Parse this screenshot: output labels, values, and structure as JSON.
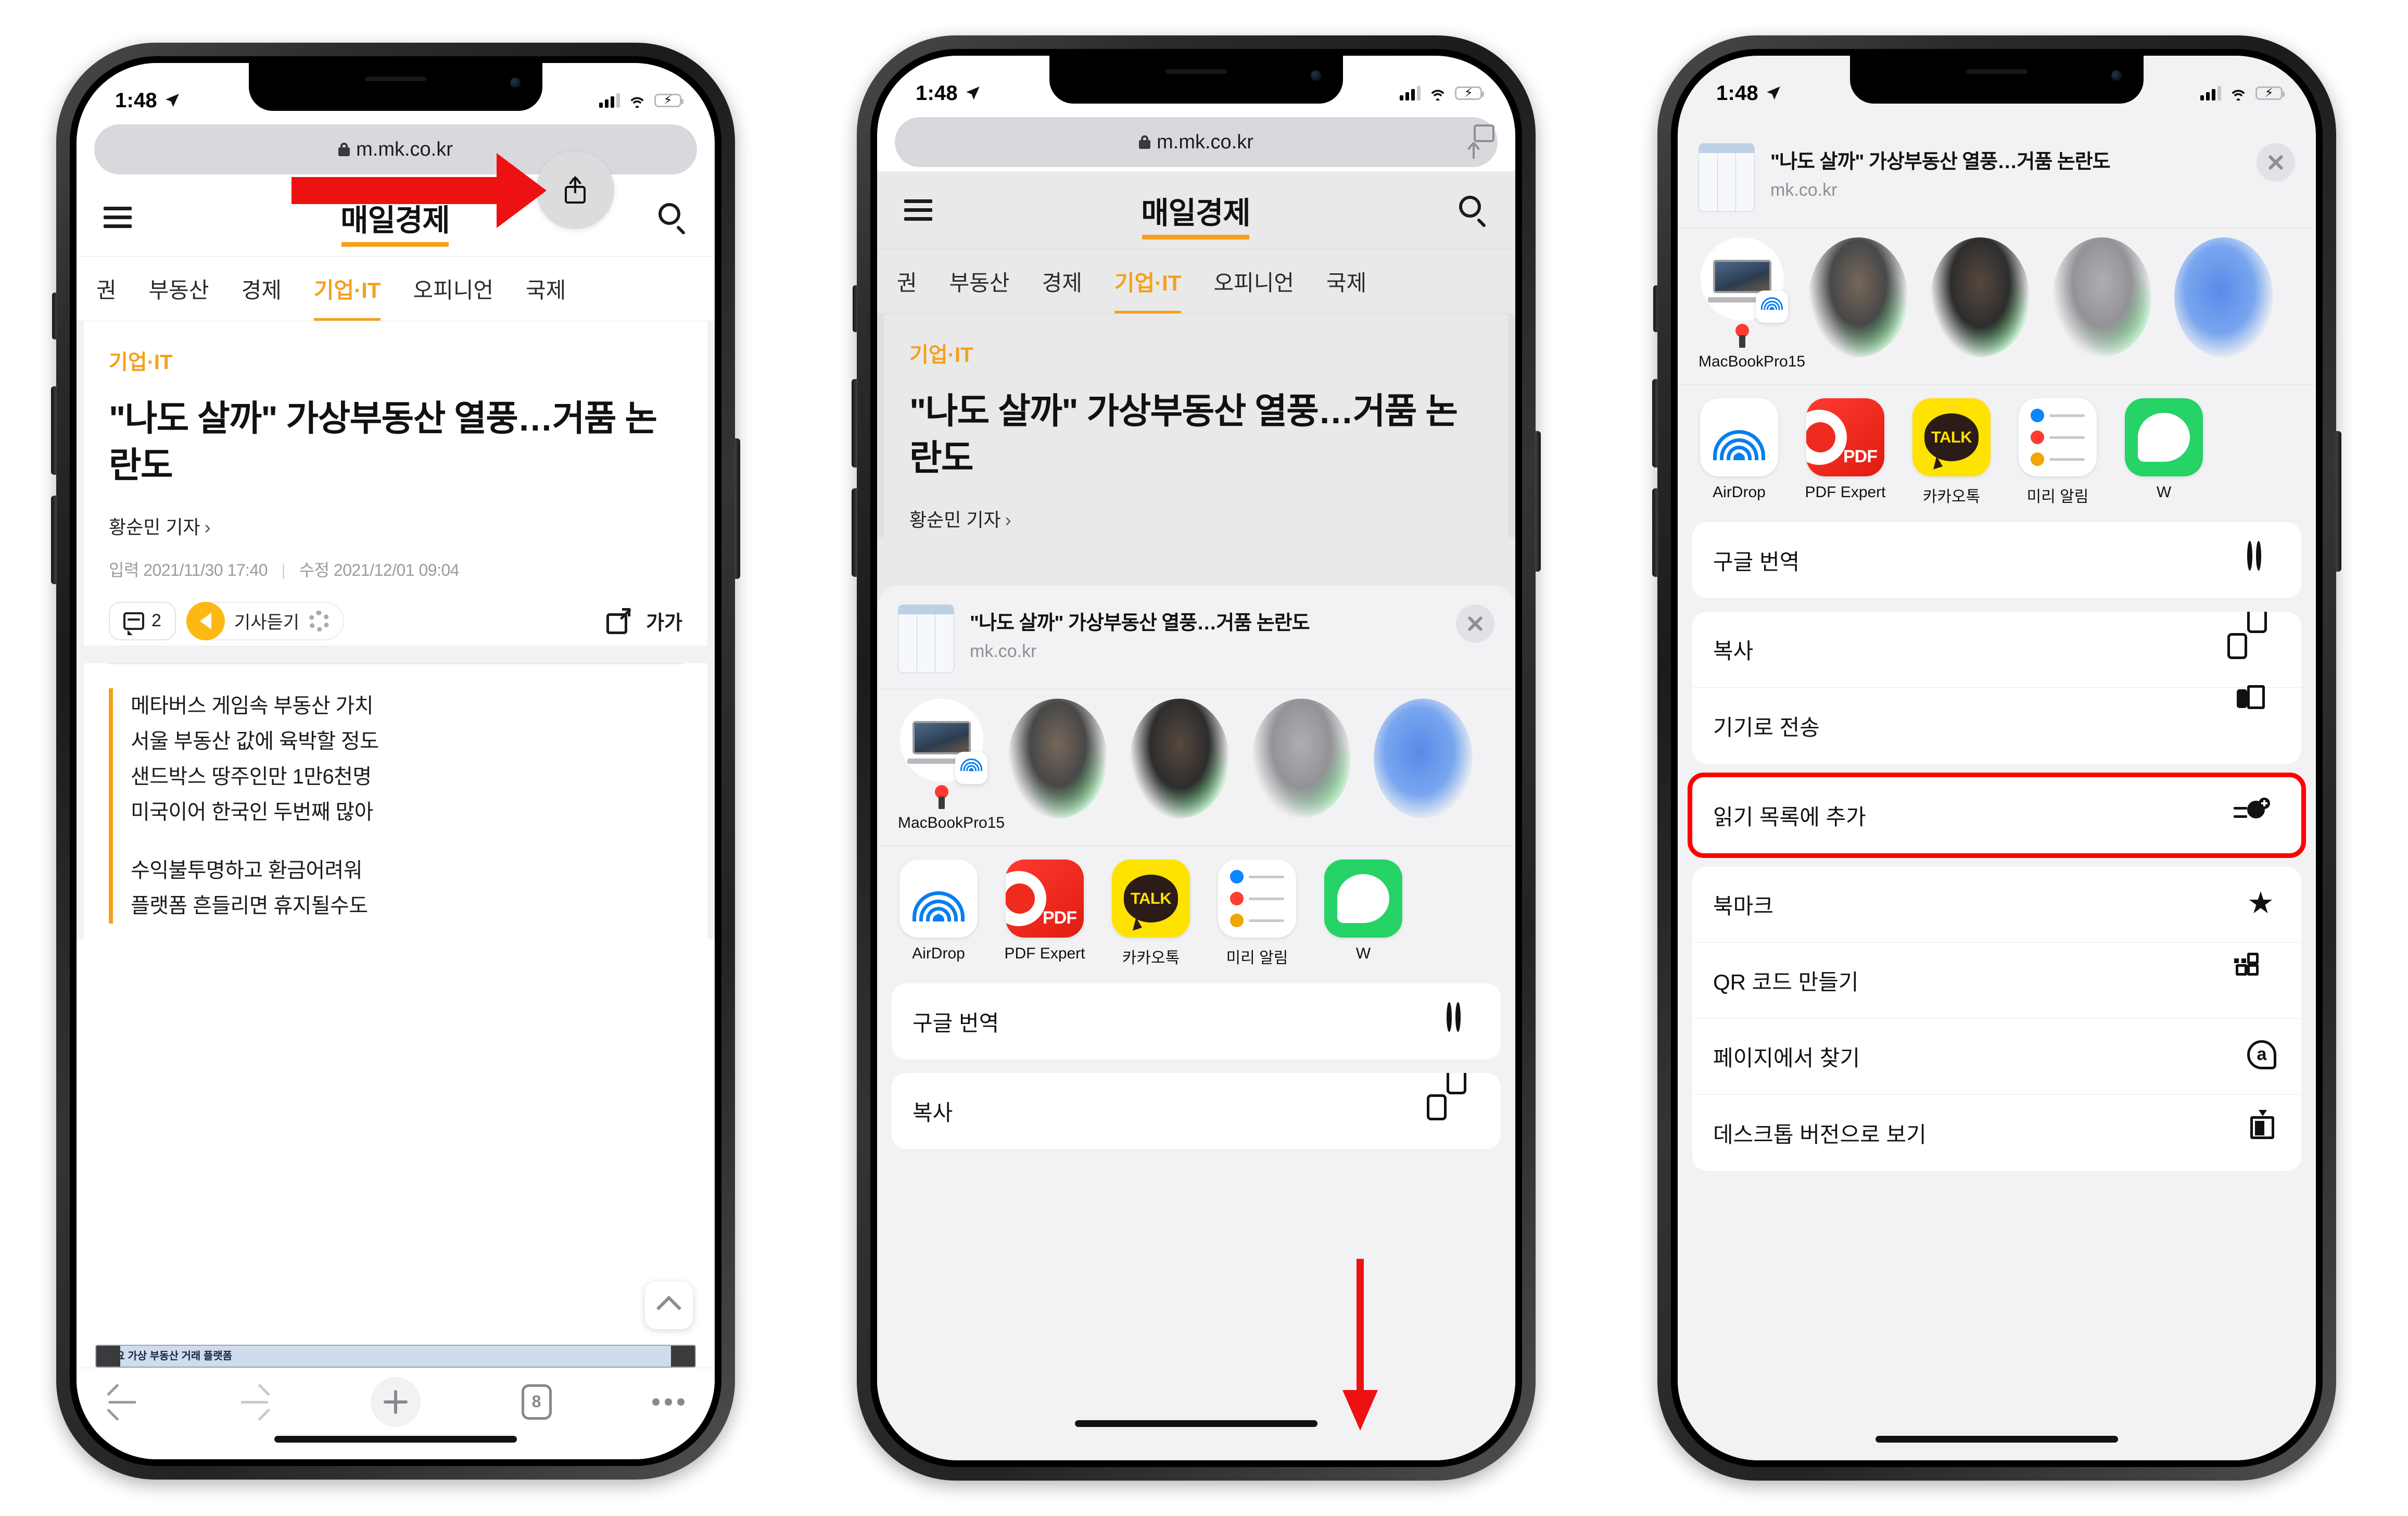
{
  "statusbar": {
    "time": "1:48",
    "location_icon": "location-arrow-icon",
    "signal_icon": "cellular-bars-icon",
    "wifi_icon": "wifi-icon",
    "battery_icon": "battery-charging-icon"
  },
  "browser": {
    "url": "m.mk.co.kr",
    "lock_icon": "lock-icon",
    "share_icon": "share-icon",
    "toolbar": {
      "back": "back-arrow-icon",
      "forward": "forward-arrow-icon",
      "new_tab": "plus-icon",
      "tab_count": "8",
      "more": "more-dots-icon"
    }
  },
  "site": {
    "brand": "매일경제",
    "menu_icon": "hamburger-icon",
    "search_icon": "search-icon",
    "nav": [
      "권",
      "부동산",
      "경제",
      "기업·IT",
      "오피니언",
      "국제"
    ],
    "nav_active": "기업·IT"
  },
  "article": {
    "kicker": "기업·IT",
    "headline": "\"나도 살까\" 가상부동산 열풍…거품 논란도",
    "byline": "황순민 기자",
    "date_input_label": "입력",
    "date_input": "2021/11/30 17:40",
    "date_edit_label": "수정",
    "date_edit": "2021/12/01 09:04",
    "comment_count": "2",
    "listen_label": "기사듣기",
    "font_size_label": "가가",
    "summary": [
      "메타버스 게임속 부동산 가치",
      "서울 부동산 값에 육박할 정도",
      "샌드박스 땅주인만 1만6천명",
      "미국이어 한국인 두번째 많아"
    ],
    "summary2": [
      "수익불투명하고 환금어려워",
      "플랫폼 흔들리면 휴지될수도"
    ],
    "image_caption": "주요 가상 부동산 거래 플랫폼"
  },
  "share_sheet": {
    "title": "\"나도 살까\" 가상부동산 열풍…거품 논란도",
    "host": "mk.co.kr",
    "close_icon": "close-icon",
    "airdrop_target": {
      "name": "MacBookPro15",
      "icon": "macbook-icon",
      "badge": "airdrop-icon",
      "pin": "pin-icon"
    },
    "apps": [
      {
        "name": "AirDrop",
        "icon": "airdrop-icon"
      },
      {
        "name": "PDF Expert",
        "icon": "pdf-expert-icon",
        "badge": "PDF"
      },
      {
        "name": "카카오톡",
        "icon": "kakaotalk-icon",
        "badge": "TALK"
      },
      {
        "name": "미리 알림",
        "icon": "reminders-icon"
      },
      {
        "name": "W",
        "icon": "whatsapp-icon"
      }
    ],
    "menu_group_1": [
      {
        "label": "구글 번역",
        "icon": "globe-icon"
      }
    ],
    "menu_group_2": [
      {
        "label": "복사",
        "icon": "copy-icon"
      },
      {
        "label": "기기로 전송",
        "icon": "send-to-device-icon"
      }
    ],
    "menu_highlighted": {
      "label": "읽기 목록에 추가",
      "icon": "add-to-reading-list-icon"
    },
    "menu_group_3": [
      {
        "label": "북마크",
        "icon": "star-icon"
      },
      {
        "label": "QR 코드 만들기",
        "icon": "qr-code-icon"
      },
      {
        "label": "페이지에서 찾기",
        "icon": "find-on-page-icon"
      },
      {
        "label": "데스크톱 버전으로 보기",
        "icon": "desktop-site-icon"
      }
    ]
  },
  "annotations": {
    "arrow1": "red-arrow-pointing-to-share-button",
    "arrow2": "red-arrow-pointing-down-scroll",
    "highlight": "red-outline-on-reading-list-item"
  },
  "colors": {
    "accent": "#f5a01b",
    "annotation": "#ee1111",
    "link_blue": "#067ef0",
    "battery_green": "#32d74b"
  }
}
